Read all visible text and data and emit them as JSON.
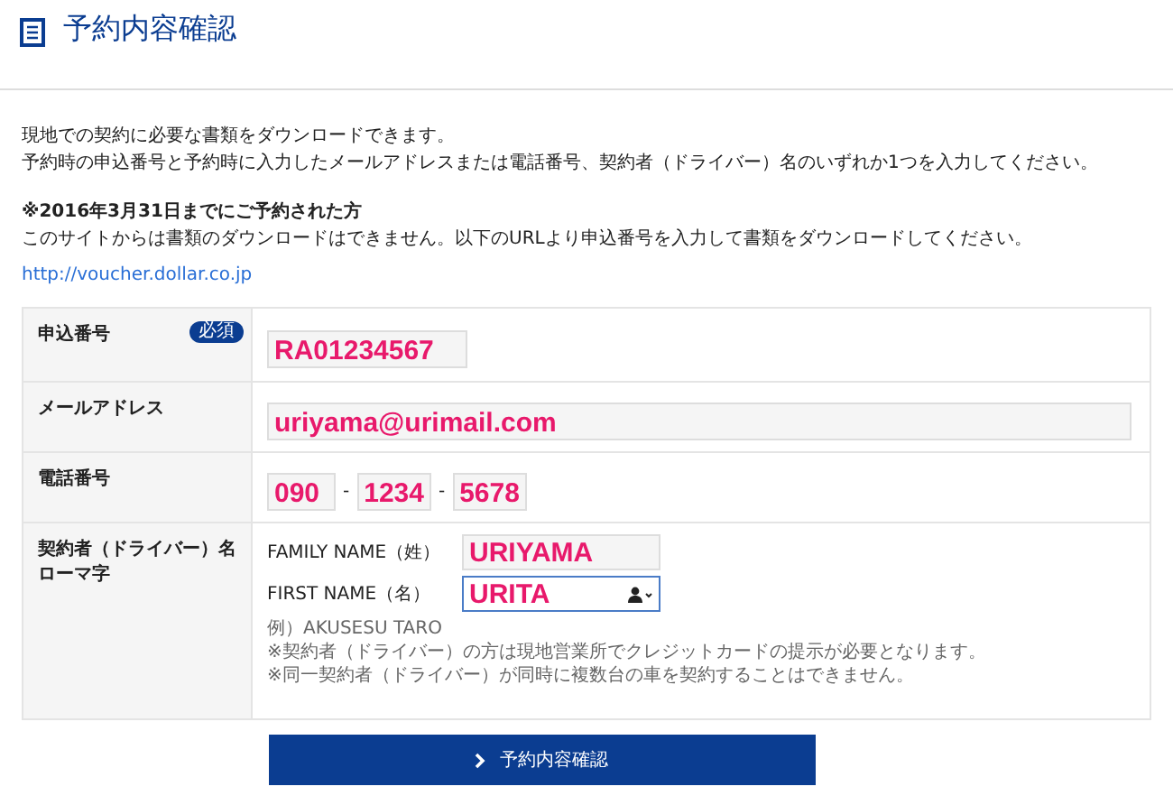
{
  "page_title": "予約内容確認",
  "intro": [
    "現地での契約に必要な書類をダウンロードできます。",
    "予約時の申込番号と予約時に入力したメールアドレスまたは電話番号、契約者（ドライバー）名のいずれか1つを入力してください。"
  ],
  "notice": {
    "heading": "※2016年3月31日までにご予約された方",
    "text": "このサイトからは書類のダウンロードはできません。以下のURLより申込番号を入力して書類をダウンロードしてください。",
    "link": "http://voucher.dollar.co.jp"
  },
  "form": {
    "order_number": {
      "label": "申込番号",
      "badge": "必須",
      "value": "RA01234567"
    },
    "email": {
      "label": "メールアドレス",
      "value": "uriyama@urimail.com"
    },
    "phone": {
      "label": "電話番号",
      "parts": [
        "090",
        "1234",
        "5678"
      ],
      "separator": "-"
    },
    "name": {
      "label": [
        "契約者（ドライバー）名",
        "ローマ字"
      ],
      "fields": [
        {
          "label": "FAMILY NAME（姓）",
          "value": "URIYAMA",
          "focused": false
        },
        {
          "label": "FIRST NAME（名）",
          "value": "URITA",
          "focused": true
        }
      ],
      "notes": [
        "例）AKUSESU TARO",
        "※契約者（ドライバー）の方は現地営業所でクレジットカードの提示が必要となります。",
        "※同一契約者（ドライバー）が同時に複数台の車を契約することはできません。"
      ]
    }
  },
  "submit": {
    "label": "予約内容確認"
  }
}
